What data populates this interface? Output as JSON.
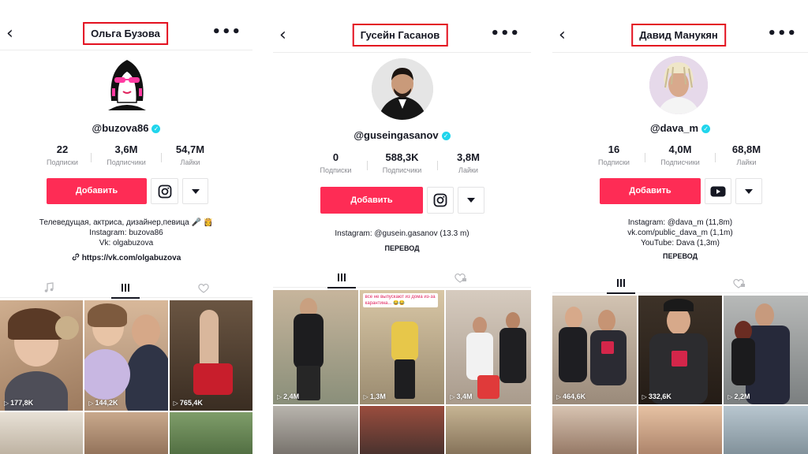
{
  "icons": {
    "back": "chevron-left-icon",
    "more": "more-horizontal-icon",
    "verified": "verified-badge-icon",
    "instagram": "instagram-icon",
    "youtube": "youtube-icon",
    "dropdown": "caret-down-icon",
    "link": "link-icon",
    "music": "music-note-icon",
    "grid": "grid-icon",
    "heart": "heart-icon",
    "liked_hidden": "heart-lock-icon",
    "play": "play-icon"
  },
  "colors": {
    "accent": "#fe2c55",
    "highlight_box": "#e3101f",
    "verified": "#20d5ec"
  },
  "profiles": [
    {
      "name": "Ольга Бузова",
      "handle": "@buzova86",
      "stats": [
        {
          "value": "22",
          "label": "Подписки"
        },
        {
          "value": "3,6M",
          "label": "Подписчики"
        },
        {
          "value": "54,7M",
          "label": "Лайки"
        }
      ],
      "follow_label": "Добавить",
      "bio_lines": [
        "Телеведущая, актриса, дизайнер,певица 🎤 👸",
        "Instagram: buzova86",
        "Vk: olgabuzova"
      ],
      "link": "https://vk.com/olgabuzova",
      "video_views": [
        "177,8K",
        "144,2K",
        "765,4K"
      ]
    },
    {
      "name": "Гусейн Гасанов",
      "handle": "@guseingasanov",
      "stats": [
        {
          "value": "0",
          "label": "Подписки"
        },
        {
          "value": "588,3K",
          "label": "Подписчики"
        },
        {
          "value": "3,8M",
          "label": "Лайки"
        }
      ],
      "follow_label": "Добавить",
      "bio_lines": [
        "Instagram: @gusein.gasanov (13.3 m)"
      ],
      "translate_label": "ПЕРЕВОД",
      "video_views": [
        "2,4M",
        "1,3M",
        "3,4M"
      ],
      "sticker_text": "все не выпускают из дома из-за карантина... 😂😂"
    },
    {
      "name": "Давид Манукян",
      "handle": "@dava_m",
      "stats": [
        {
          "value": "16",
          "label": "Подписки"
        },
        {
          "value": "4,0M",
          "label": "Подписчики"
        },
        {
          "value": "68,8M",
          "label": "Лайки"
        }
      ],
      "follow_label": "Добавить",
      "bio_lines": [
        "Instagram: @dava_m (11,8m)",
        "vk.com/public_dava_m (1,1m)",
        "YouTube: Dava (1,3m)"
      ],
      "translate_label": "ПЕРЕВОД",
      "video_views": [
        "464,6K",
        "332,6K",
        "2,2M"
      ]
    }
  ]
}
